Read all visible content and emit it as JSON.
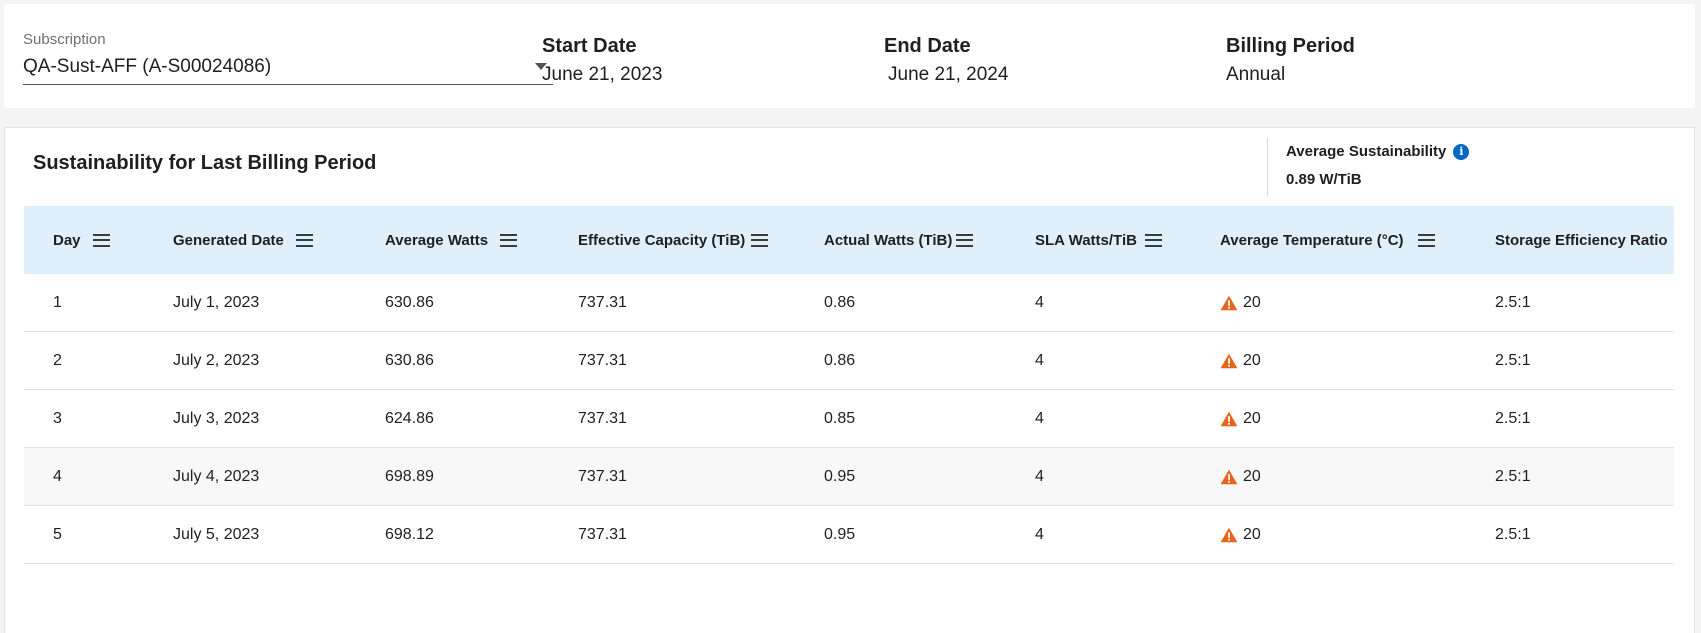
{
  "subscription": {
    "label": "Subscription",
    "value": "QA-Sust-AFF (A-S00024086)"
  },
  "start_date": {
    "title": "Start Date",
    "value": "June 21, 2023"
  },
  "end_date": {
    "title": "End Date",
    "value": "June 21, 2024"
  },
  "billing_period": {
    "title": "Billing Period",
    "value": "Annual"
  },
  "card": {
    "title": "Sustainability for Last Billing Period",
    "average_label": "Average Sustainability",
    "average_value": "0.89 W/TiB",
    "info_icon": "info-icon"
  },
  "colors": {
    "header_bg": "#dfeffb",
    "warning": "#e8641b",
    "info": "#0067c5"
  },
  "table": {
    "columns": [
      "Day",
      "Generated Date",
      "Average Watts",
      "Effective Capacity (TiB)",
      "Actual Watts (TiB)",
      "SLA Watts/TiB",
      "Average Temperature (°C)",
      "Storage Efficiency Ratio"
    ],
    "rows": [
      {
        "day": "1",
        "date": "July 1, 2023",
        "avg_watts": "630.86",
        "capacity": "737.31",
        "actual": "0.86",
        "sla": "4",
        "temp": "20",
        "ratio": "2.5:1"
      },
      {
        "day": "2",
        "date": "July 2, 2023",
        "avg_watts": "630.86",
        "capacity": "737.31",
        "actual": "0.86",
        "sla": "4",
        "temp": "20",
        "ratio": "2.5:1"
      },
      {
        "day": "3",
        "date": "July 3, 2023",
        "avg_watts": "624.86",
        "capacity": "737.31",
        "actual": "0.85",
        "sla": "4",
        "temp": "20",
        "ratio": "2.5:1"
      },
      {
        "day": "4",
        "date": "July 4, 2023",
        "avg_watts": "698.89",
        "capacity": "737.31",
        "actual": "0.95",
        "sla": "4",
        "temp": "20",
        "ratio": "2.5:1"
      },
      {
        "day": "5",
        "date": "July 5, 2023",
        "avg_watts": "698.12",
        "capacity": "737.31",
        "actual": "0.95",
        "sla": "4",
        "temp": "20",
        "ratio": "2.5:1"
      }
    ]
  }
}
